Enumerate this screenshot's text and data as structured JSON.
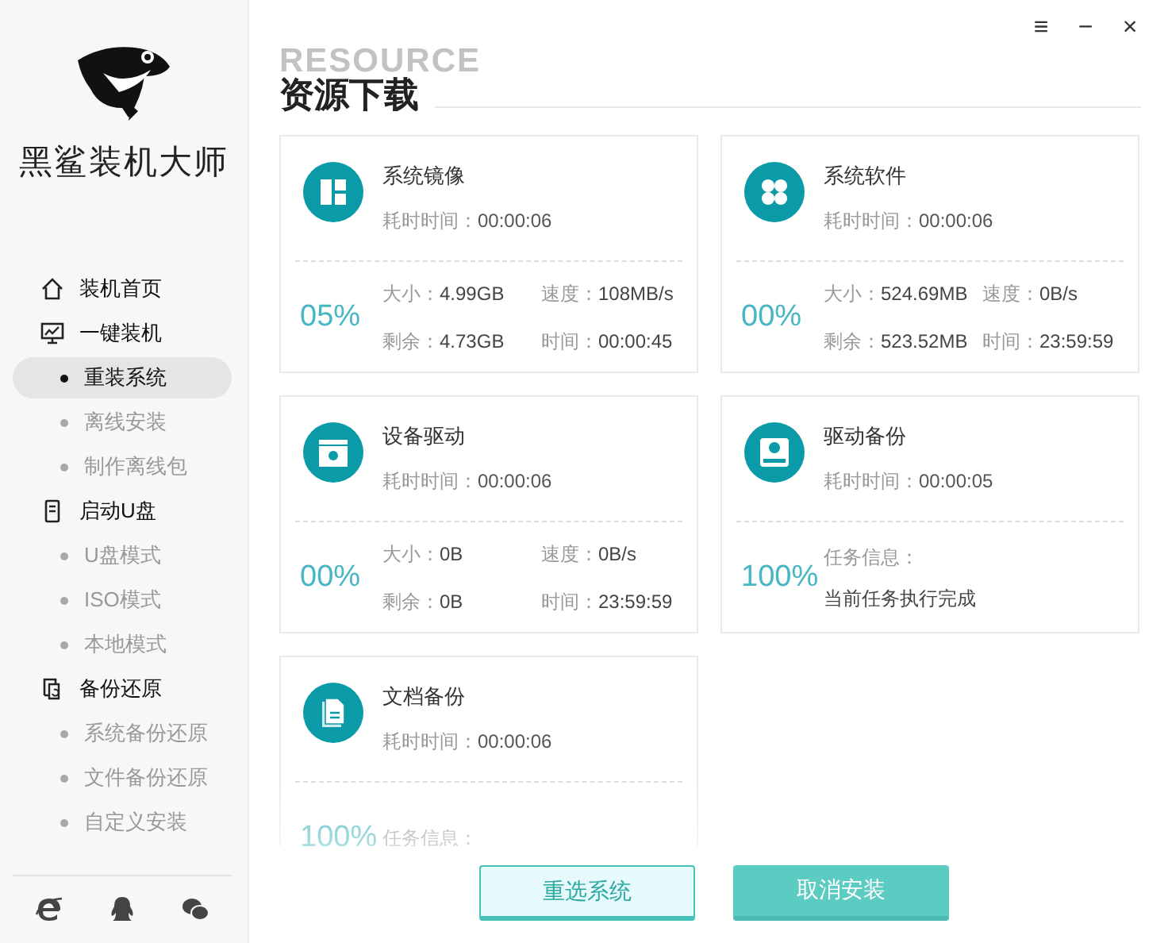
{
  "app": {
    "brand": "黑鲨装机大师"
  },
  "nav": [
    {
      "label": "装机首页"
    },
    {
      "label": "一键装机",
      "children": [
        {
          "label": "重装系统",
          "selected": true
        },
        {
          "label": "离线安装",
          "selected": false
        },
        {
          "label": "制作离线包",
          "selected": false
        }
      ]
    },
    {
      "label": "启动U盘",
      "children": [
        {
          "label": "U盘模式",
          "selected": false
        },
        {
          "label": "ISO模式",
          "selected": false
        },
        {
          "label": "本地模式",
          "selected": false
        }
      ]
    },
    {
      "label": "备份还原",
      "children": [
        {
          "label": "系统备份还原",
          "selected": false
        },
        {
          "label": "文件备份还原",
          "selected": false
        },
        {
          "label": "自定义安装",
          "selected": false
        }
      ]
    }
  ],
  "window_controls": [
    "≡",
    "−",
    "×"
  ],
  "page": {
    "title": "资源下载",
    "backdrop_word": "RESOURCE"
  },
  "cards": [
    {
      "kind": "stats",
      "title": "系统镜像",
      "elapsed_label": "耗时时间：",
      "elapsed": "00:00:06",
      "percent": "05%",
      "stats": [
        {
          "label": "大小：",
          "value": "4.99GB"
        },
        {
          "label": "速度：",
          "value": "108MB/s"
        },
        {
          "label": "剩余：",
          "value": "4.73GB"
        },
        {
          "label": "时间：",
          "value": "00:00:45"
        }
      ]
    },
    {
      "kind": "stats",
      "title": "系统软件",
      "elapsed_label": "耗时时间：",
      "elapsed": "00:00:06",
      "percent": "00%",
      "stats": [
        {
          "label": "大小：",
          "value": "524.69MB"
        },
        {
          "label": "速度：",
          "value": "0B/s"
        },
        {
          "label": "剩余：",
          "value": "523.52MB"
        },
        {
          "label": "时间：",
          "value": "23:59:59"
        }
      ]
    },
    {
      "kind": "stats",
      "title": "设备驱动",
      "elapsed_label": "耗时时间：",
      "elapsed": "00:00:06",
      "percent": "00%",
      "stats": [
        {
          "label": "大小：",
          "value": "0B"
        },
        {
          "label": "速度：",
          "value": "0B/s"
        },
        {
          "label": "剩余：",
          "value": "0B"
        },
        {
          "label": "时间：",
          "value": "23:59:59"
        }
      ]
    },
    {
      "kind": "task",
      "title": "驱动备份",
      "elapsed_label": "耗时时间：",
      "elapsed": "00:00:05",
      "percent": "100%",
      "info_label": "任务信息：",
      "info": "当前任务执行完成"
    },
    {
      "kind": "task",
      "title": "文档备份",
      "elapsed_label": "耗时时间：",
      "elapsed": "00:00:06",
      "percent": "100%",
      "info_label": "任务信息："
    }
  ],
  "buttons": [
    {
      "label": "重选系统",
      "kind": "secondary"
    },
    {
      "label": "取消安装",
      "kind": "primary"
    }
  ]
}
